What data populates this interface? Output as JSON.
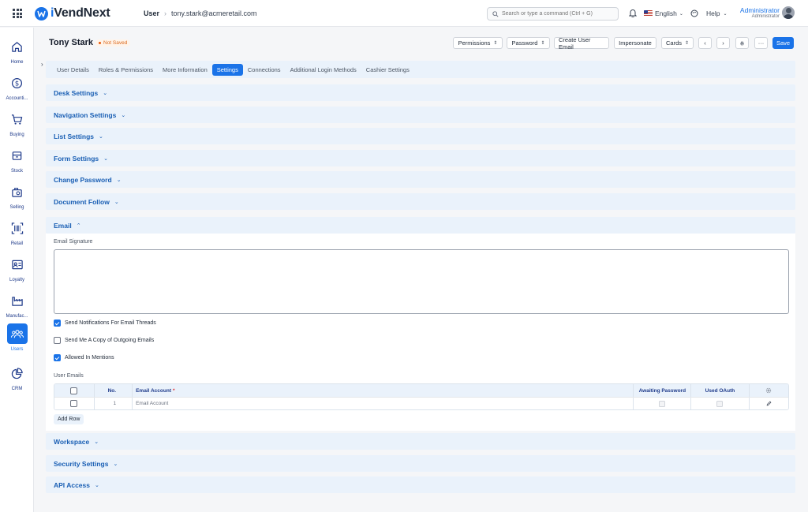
{
  "app": {
    "brand_prefix": "i",
    "brand_name": "VendNext",
    "breadcrumb": [
      "User",
      "tony.stark@acmeretail.com"
    ]
  },
  "topbar": {
    "search_placeholder": "Search or type a command (Ctrl + G)",
    "language": "English",
    "help": "Help",
    "user_name": "Administrator",
    "user_role": "Administrator"
  },
  "sidebar": {
    "items": [
      {
        "label": "Home",
        "icon": "home-icon"
      },
      {
        "label": "Accounti...",
        "icon": "dollar-icon"
      },
      {
        "label": "Buying",
        "icon": "cart-icon"
      },
      {
        "label": "Stock",
        "icon": "box-icon"
      },
      {
        "label": "Selling",
        "icon": "selling-icon"
      },
      {
        "label": "Retail",
        "icon": "barcode-icon"
      },
      {
        "label": "Loyalty",
        "icon": "loyalty-card-icon"
      },
      {
        "label": "Manufac...",
        "icon": "factory-icon"
      },
      {
        "label": "Users",
        "icon": "users-icon"
      },
      {
        "label": "CRM",
        "icon": "pie-chart-icon"
      }
    ],
    "active": "Users"
  },
  "page": {
    "title": "Tony Stark",
    "status": "Not Saved",
    "actions": {
      "permissions": "Permissions",
      "password": "Password",
      "create_user_email": "Create User Email",
      "impersonate": "Impersonate",
      "cards": "Cards",
      "save": "Save"
    }
  },
  "tabs": [
    "User Details",
    "Roles & Permissions",
    "More Information",
    "Settings",
    "Connections",
    "Additional Login Methods",
    "Cashier Settings"
  ],
  "active_tab": "Settings",
  "sections_top": [
    "Desk Settings",
    "Navigation Settings",
    "List Settings",
    "Form Settings",
    "Change Password",
    "Document Follow"
  ],
  "email": {
    "title": "Email",
    "signature_label": "Email Signature",
    "signature_value": "",
    "checks": [
      {
        "label": "Send Notifications For Email Threads",
        "checked": true
      },
      {
        "label": "Send Me A Copy of Outgoing Emails",
        "checked": false
      },
      {
        "label": "Allowed In Mentions",
        "checked": true
      }
    ],
    "user_emails_label": "User Emails",
    "table_headers": {
      "no": "No.",
      "email_account": "Email Account",
      "awaiting": "Awaiting Password",
      "oauth": "Used OAuth"
    },
    "rows": [
      {
        "no": "1",
        "email_account": "Email Account"
      }
    ],
    "add_row": "Add Row"
  },
  "sections_bottom": [
    "Workspace",
    "Security Settings",
    "API Access"
  ],
  "colors": {
    "accent": "#1a73e8",
    "section_bg": "#eaf2fb",
    "status": "#e8590c"
  }
}
